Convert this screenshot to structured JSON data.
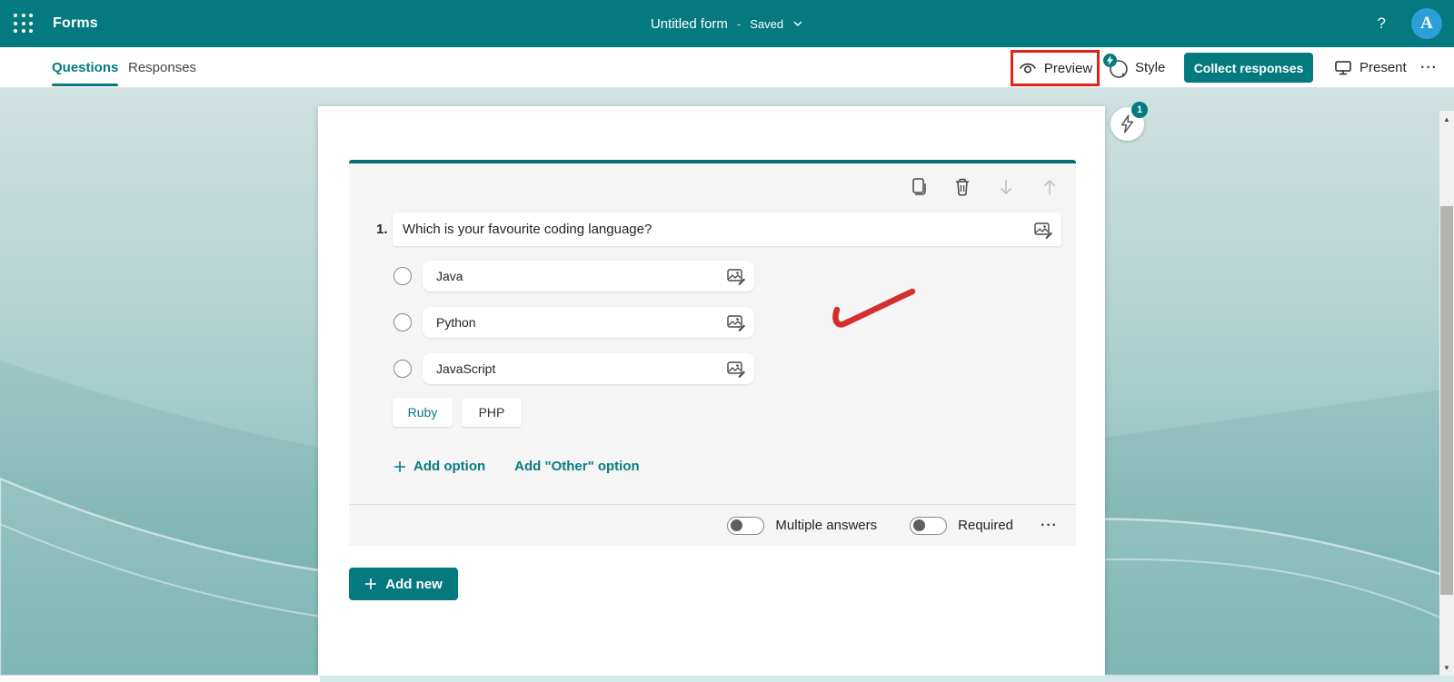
{
  "header": {
    "app_title": "Forms",
    "form_title": "Untitled form",
    "title_separator": "-",
    "save_status": "Saved",
    "help_label": "?",
    "avatar_initial": "A"
  },
  "toolbar": {
    "tabs": [
      {
        "label": "Questions",
        "active": true
      },
      {
        "label": "Responses",
        "active": false
      }
    ],
    "preview_label": "Preview",
    "style_label": "Style",
    "collect_label": "Collect responses",
    "present_label": "Present",
    "more_glyph": "···"
  },
  "ideas": {
    "badge_count": "1"
  },
  "question": {
    "number": "1.",
    "title": "Which is your favourite coding language?",
    "options": [
      {
        "label": "Java"
      },
      {
        "label": "Python"
      },
      {
        "label": "JavaScript"
      }
    ],
    "suggestions": [
      {
        "label": "Ruby"
      },
      {
        "label": "PHP"
      }
    ],
    "add_option_label": "Add option",
    "add_other_label": "Add \"Other\" option",
    "toggles": [
      {
        "label": "Multiple answers",
        "on": false
      },
      {
        "label": "Required",
        "on": false
      }
    ],
    "more_glyph": "···"
  },
  "add_new_label": "Add new",
  "scrollbar": {
    "up_glyph": "▲",
    "down_glyph": "▼"
  },
  "annotations": {
    "highlight": "red box around Preview",
    "checkmark_color": "#d32f2f"
  },
  "icons": {
    "app-launcher-icon": "3x3 dot grid",
    "help-icon": "?",
    "preview-icon": "eye",
    "style-icon": "theme circle with lightning badge",
    "present-icon": "monitor",
    "more-icon": "ellipsis",
    "copy-icon": "duplicate pages",
    "delete-icon": "trash can",
    "move-down-icon": "arrow down",
    "move-up-icon": "arrow up",
    "insert-image-icon": "picture with pencil",
    "add-icon": "plus",
    "ideas-icon": "lightning bolt",
    "chevron-down-icon": "chevron"
  },
  "colors": {
    "accent_teal": "#047a7e",
    "annotation_red": "#e0241a",
    "avatar_blue": "#2d9fd8",
    "question_bg": "#f5f5f5",
    "canvas_top": "#cfe2e1",
    "canvas_bottom": "#74b4b1"
  }
}
